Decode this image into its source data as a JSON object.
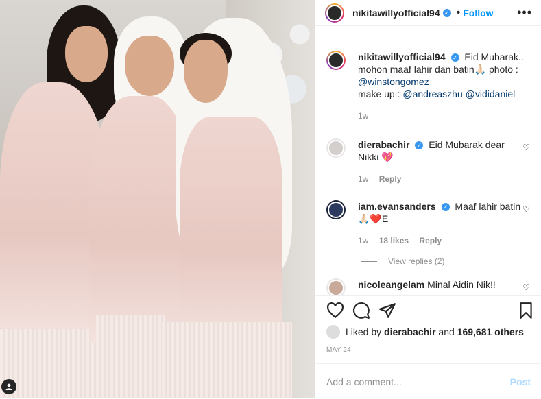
{
  "post": {
    "author": "nikitawillyofficial94",
    "follow_label": "Follow",
    "separator": "•",
    "more": "•••"
  },
  "caption": {
    "author": "nikitawillyofficial94",
    "text_1": "Eid Mubarak..",
    "text_2": "mohon maaf lahir dan batin🙏🏻 photo :",
    "mention_photo": "@winstongomez",
    "text_3": "make up :",
    "mention_mua1": "@andreaszhu",
    "mention_mua2": "@vididaniel",
    "time": "1w"
  },
  "comments": [
    {
      "author": "dierabachir",
      "text": "Eid Mubarak dear Nikki 💖",
      "time": "1w",
      "likes": "",
      "reply": "Reply"
    },
    {
      "author": "iam.evansanders",
      "text": "Maaf lahir batin🙏🏻❤️E",
      "time": "1w",
      "likes": "18 likes",
      "reply": "Reply"
    },
    {
      "author": "nicoleangelam",
      "text": "Minal Aidin Nik!!",
      "time": "",
      "likes": "",
      "reply": ""
    }
  ],
  "view_replies": "View replies (2)",
  "likes": {
    "prefix": "Liked by",
    "user": "dierabachir",
    "and": "and",
    "count": "169,681 others"
  },
  "date": "MAY 24",
  "add_comment": {
    "placeholder": "Add a comment...",
    "post_label": "Post"
  },
  "colors": {
    "link": "#0095f6",
    "mention": "#00376b",
    "muted": "#8e8e8e"
  }
}
